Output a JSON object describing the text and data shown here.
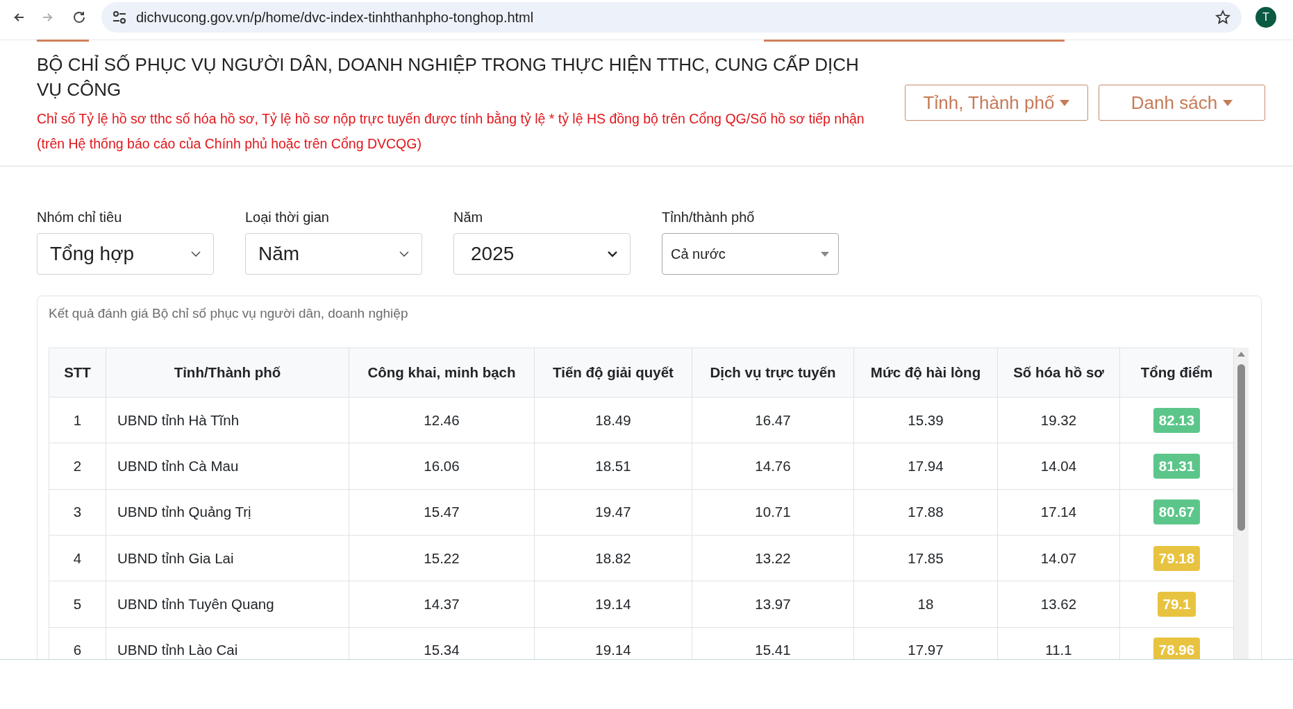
{
  "browser": {
    "url": "dichvucong.gov.vn/p/home/dvc-index-tinhthanhpho-tonghop.html",
    "back_disabled": false,
    "forward_disabled": true,
    "avatar": "T"
  },
  "header": {
    "title": "BỘ CHỈ SỐ PHỤC VỤ NGƯỜI DÂN, DOANH NGHIỆP TRONG THỰC HIỆN TTHC, CUNG CẤP DỊCH VỤ CÔNG",
    "note": "Chỉ số Tỷ lệ hồ sơ tthc số hóa hồ sơ, Tỷ lệ hồ sơ nộp trực tuyến được tính bằng tỷ lệ * tỷ lệ HS đồng bộ trên Cổng QG/Số hồ sơ tiếp nhận (trên Hệ thống báo cáo của Chính phủ hoặc trên Cổng DVCQG)",
    "buttons": [
      "Tỉnh, Thành phố",
      "Danh sách"
    ]
  },
  "filters": [
    {
      "label": "Nhóm chỉ tiêu",
      "value": "Tổng hợp",
      "kind": "select"
    },
    {
      "label": "Loại thời gian",
      "value": "Năm",
      "kind": "select"
    },
    {
      "label": "Năm",
      "value": "2025",
      "kind": "native"
    },
    {
      "label": "Tỉnh/thành phố",
      "value": "Cả nước",
      "kind": "combo"
    }
  ],
  "card": {
    "caption": "Kết quả đánh giá Bộ chỉ số phục vụ người dân, doanh nghiệp"
  },
  "table": {
    "columns": [
      "STT",
      "Tỉnh/Thành phố",
      "Công khai, minh bạch",
      "Tiến độ giải quyết",
      "Dịch vụ trực tuyến",
      "Mức độ hài lòng",
      "Số hóa hồ sơ",
      "Tổng điểm"
    ],
    "rows": [
      {
        "cells": [
          "1",
          "UBND tỉnh Hà Tĩnh",
          "12.46",
          "18.49",
          "16.47",
          "15.39",
          "19.32"
        ],
        "total": "82.13",
        "color": "#5cc68a"
      },
      {
        "cells": [
          "2",
          "UBND tỉnh Cà Mau",
          "16.06",
          "18.51",
          "14.76",
          "17.94",
          "14.04"
        ],
        "total": "81.31",
        "color": "#5cc68a"
      },
      {
        "cells": [
          "3",
          "UBND tỉnh Quảng Trị",
          "15.47",
          "19.47",
          "10.71",
          "17.88",
          "17.14"
        ],
        "total": "80.67",
        "color": "#5cc68a"
      },
      {
        "cells": [
          "4",
          "UBND tỉnh Gia Lai",
          "15.22",
          "18.82",
          "13.22",
          "17.85",
          "14.07"
        ],
        "total": "79.18",
        "color": "#e8c340"
      },
      {
        "cells": [
          "5",
          "UBND tỉnh Tuyên Quang",
          "14.37",
          "19.14",
          "13.97",
          "18",
          "13.62"
        ],
        "total": "79.1",
        "color": "#e8c340"
      },
      {
        "cells": [
          "6",
          "UBND tỉnh Lào Cai",
          "15.34",
          "19.14",
          "15.41",
          "17.97",
          "11.1"
        ],
        "total": "78.96",
        "color": "#e8c340"
      }
    ]
  }
}
